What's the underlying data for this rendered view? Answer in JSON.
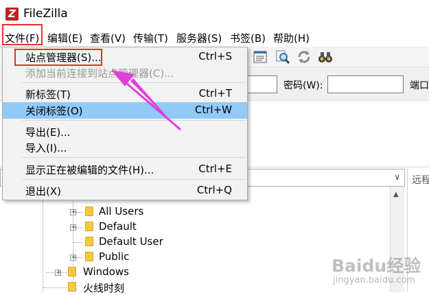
{
  "window": {
    "title": "FileZilla",
    "logo": "filezilla-logo"
  },
  "menubar": [
    {
      "label": "文件(F)"
    },
    {
      "label": "编辑(E)"
    },
    {
      "label": "查看(V)"
    },
    {
      "label": "传输(T)"
    },
    {
      "label": "服务器(S)"
    },
    {
      "label": "书签(B)"
    },
    {
      "label": "帮助(H)"
    }
  ],
  "file_menu": {
    "items": [
      {
        "label": "站点管理器(S)...",
        "shortcut": "Ctrl+S",
        "state": "normal"
      },
      {
        "label": "添加当前连接到站点管理器(C)...",
        "shortcut": "",
        "state": "disabled"
      },
      {
        "label": "新标签(T)",
        "shortcut": "Ctrl+T",
        "state": "normal"
      },
      {
        "label": "关闭标签(O)",
        "shortcut": "Ctrl+W",
        "state": "highlighted"
      },
      {
        "label": "导出(E)...",
        "shortcut": "",
        "state": "normal"
      },
      {
        "label": "导入(I)...",
        "shortcut": "",
        "state": "normal"
      },
      {
        "label": "显示正在被编辑的文件(H)...",
        "shortcut": "Ctrl+E",
        "state": "normal"
      },
      {
        "label": "退出(X)",
        "shortcut": "Ctrl+Q",
        "state": "normal"
      }
    ]
  },
  "quickconnect": {
    "password_label": "密码(W):",
    "port_label": "端口",
    "host_value": "",
    "password_value": ""
  },
  "local_tree": {
    "items": [
      {
        "label": "All Users",
        "expandable": true
      },
      {
        "label": "Default",
        "expandable": true
      },
      {
        "label": "Default User",
        "expandable": false
      },
      {
        "label": "Public",
        "expandable": true
      },
      {
        "label": "Windows",
        "expandable": true
      },
      {
        "label": "火线时刻",
        "expandable": false
      }
    ]
  },
  "remote_pane": {
    "label": "远程"
  },
  "watermark": {
    "text": "Baidu经验",
    "url": "jingyan.baidu.com"
  },
  "colors": {
    "highlight": "#91c9f7",
    "annotation": "#e4312b",
    "arrow": "#e040d8",
    "folder": "#f5c842"
  }
}
